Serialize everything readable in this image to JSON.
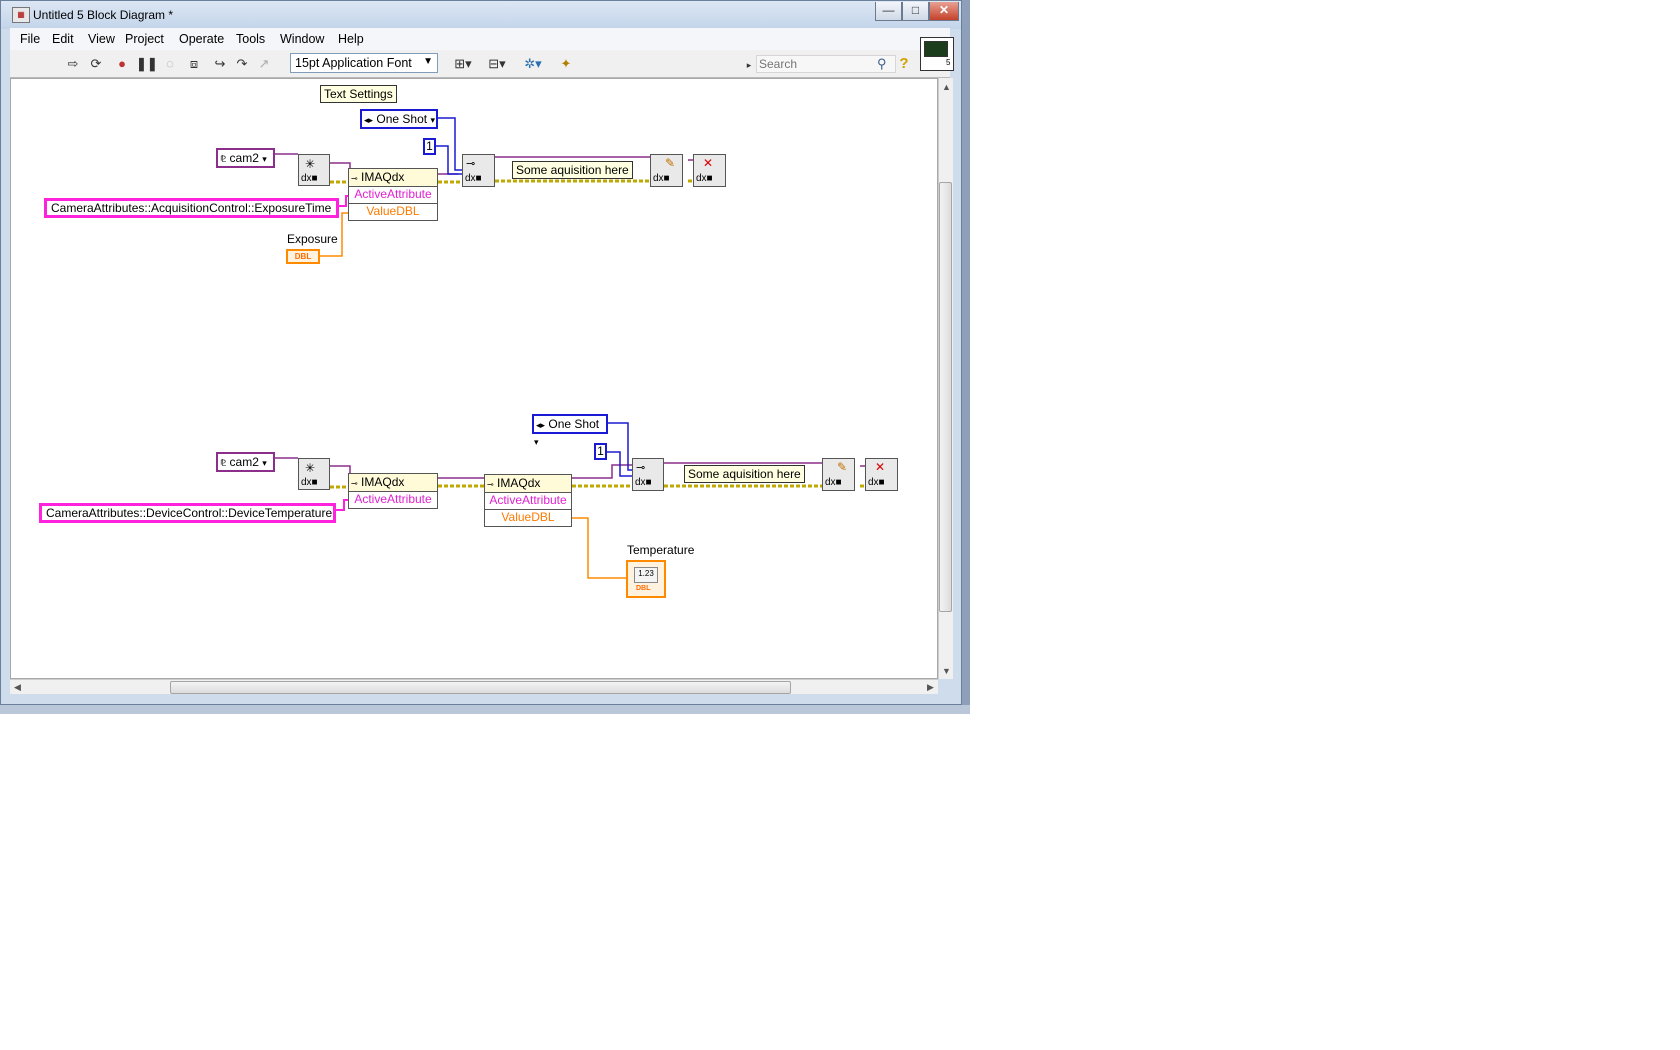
{
  "window": {
    "title": "Untitled 5 Block Diagram *",
    "minimize_label": "—",
    "maximize_label": "□",
    "close_label": "✕"
  },
  "menu": [
    "File",
    "Edit",
    "View",
    "Project",
    "Operate",
    "Tools",
    "Window",
    "Help"
  ],
  "toolbar": {
    "font": "15pt Application Font",
    "search_placeholder": "Search"
  },
  "diagram": {
    "text_settings_label": "Text Settings",
    "loop1": {
      "mode": "One Shot",
      "count": "1",
      "camera": "cam2",
      "attribute": "CameraAttributes::AcquisitionControl::ExposureTime",
      "property_node": "IMAQdx",
      "active_attribute": "ActiveAttribute",
      "value_dbl": "ValueDBL",
      "control_label": "Exposure",
      "control_type": "DBL",
      "comment": "Some aquisition here"
    },
    "loop2": {
      "mode": "One Shot",
      "count": "1",
      "camera": "cam2",
      "attribute": "CameraAttributes::DeviceControl::DeviceTemperature",
      "property_node_1": "IMAQdx",
      "active_attribute_1": "ActiveAttribute",
      "property_node_2": "IMAQdx",
      "active_attribute_2": "ActiveAttribute",
      "value_dbl": "ValueDBL",
      "indicator_label": "Temperature",
      "indicator_value": "1.23",
      "indicator_type": "DBL",
      "comment": "Some aquisition here"
    }
  },
  "colors": {
    "refnum_wire": "#8b2f8b",
    "string_wire": "#ff22dd",
    "enum_wire": "#1a1ad4",
    "dbl_wire": "#ff8a00",
    "error_wire": "#c8b400"
  }
}
